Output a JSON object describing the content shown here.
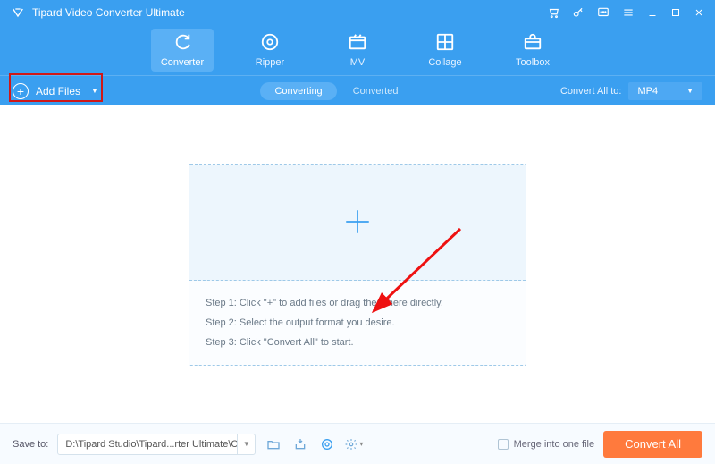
{
  "app": {
    "title": "Tipard Video Converter Ultimate"
  },
  "tabs": [
    {
      "label": "Converter"
    },
    {
      "label": "Ripper"
    },
    {
      "label": "MV"
    },
    {
      "label": "Collage"
    },
    {
      "label": "Toolbox"
    }
  ],
  "subbar": {
    "addFiles": "Add Files",
    "converting": "Converting",
    "converted": "Converted",
    "convertAllTo": "Convert All to:",
    "format": "MP4"
  },
  "steps": {
    "s1": "Step 1: Click \"+\" to add files or drag them here directly.",
    "s2": "Step 2: Select the output format you desire.",
    "s3": "Step 3: Click \"Convert All\" to start."
  },
  "footer": {
    "saveTo": "Save to:",
    "path": "D:\\Tipard Studio\\Tipard...rter Ultimate\\Converted",
    "merge": "Merge into one file",
    "convertAll": "Convert All"
  }
}
